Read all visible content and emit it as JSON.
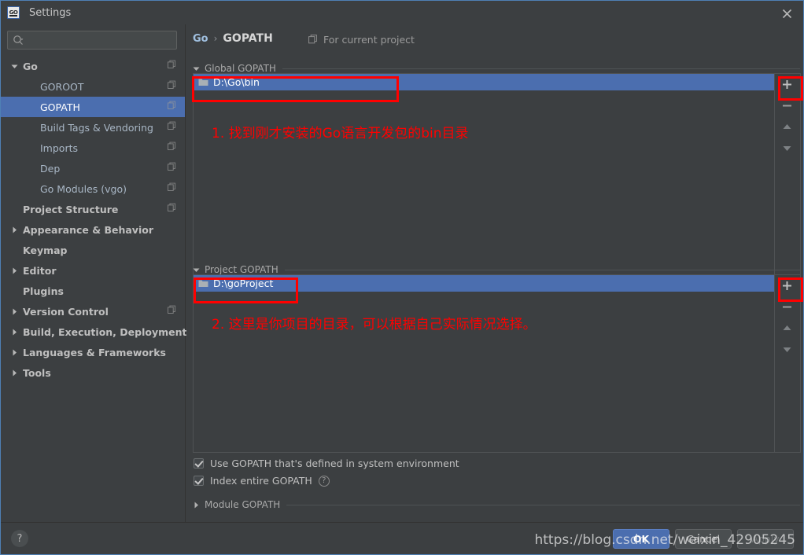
{
  "window": {
    "title": "Settings",
    "app_icon": "go-logo-icon",
    "close_icon": "close-icon",
    "accent_color": "#4b6eaf",
    "background_color": "#3c3f41",
    "annotation_color": "#ff0000"
  },
  "search": {
    "placeholder": "",
    "value": "",
    "icon": "search-icon"
  },
  "sidebar": {
    "items": [
      {
        "label": "Go",
        "indent": 0,
        "twisty": "expanded",
        "bold": true,
        "copy": true,
        "selected": false
      },
      {
        "label": "GOROOT",
        "indent": 1,
        "twisty": "none",
        "bold": false,
        "copy": true,
        "selected": false
      },
      {
        "label": "GOPATH",
        "indent": 1,
        "twisty": "none",
        "bold": false,
        "copy": true,
        "selected": true
      },
      {
        "label": "Build Tags & Vendoring",
        "indent": 1,
        "twisty": "none",
        "bold": false,
        "copy": true,
        "selected": false
      },
      {
        "label": "Imports",
        "indent": 1,
        "twisty": "none",
        "bold": false,
        "copy": true,
        "selected": false
      },
      {
        "label": "Dep",
        "indent": 1,
        "twisty": "none",
        "bold": false,
        "copy": true,
        "selected": false
      },
      {
        "label": "Go Modules (vgo)",
        "indent": 1,
        "twisty": "none",
        "bold": false,
        "copy": true,
        "selected": false
      },
      {
        "label": "Project Structure",
        "indent": 0,
        "twisty": "none",
        "bold": true,
        "copy": true,
        "selected": false
      },
      {
        "label": "Appearance & Behavior",
        "indent": 0,
        "twisty": "collapsed",
        "bold": true,
        "copy": false,
        "selected": false
      },
      {
        "label": "Keymap",
        "indent": 0,
        "twisty": "none",
        "bold": true,
        "copy": false,
        "selected": false
      },
      {
        "label": "Editor",
        "indent": 0,
        "twisty": "collapsed",
        "bold": true,
        "copy": false,
        "selected": false
      },
      {
        "label": "Plugins",
        "indent": 0,
        "twisty": "none",
        "bold": true,
        "copy": false,
        "selected": false
      },
      {
        "label": "Version Control",
        "indent": 0,
        "twisty": "collapsed",
        "bold": true,
        "copy": true,
        "selected": false
      },
      {
        "label": "Build, Execution, Deployment",
        "indent": 0,
        "twisty": "collapsed",
        "bold": true,
        "copy": false,
        "selected": false
      },
      {
        "label": "Languages & Frameworks",
        "indent": 0,
        "twisty": "collapsed",
        "bold": true,
        "copy": false,
        "selected": false
      },
      {
        "label": "Tools",
        "indent": 0,
        "twisty": "collapsed",
        "bold": true,
        "copy": false,
        "selected": false
      }
    ]
  },
  "main": {
    "breadcrumb": {
      "root": "Go",
      "separator": "›",
      "current": "GOPATH"
    },
    "for_current_project": {
      "label": "For current project",
      "icon": "copy-icon"
    },
    "global_gopath": {
      "section_label": "Global GOPATH",
      "expanded": true,
      "entries": [
        {
          "path": "D:\\Go\\bin",
          "selected": true,
          "icon": "folder-icon"
        }
      ],
      "toolbar": [
        {
          "name": "add-button",
          "glyph": "+"
        },
        {
          "name": "remove-button",
          "glyph": "−"
        },
        {
          "name": "move-up-button",
          "glyph": "▲"
        },
        {
          "name": "move-down-button",
          "glyph": "▼"
        }
      ]
    },
    "project_gopath": {
      "section_label": "Project GOPATH",
      "expanded": true,
      "entries": [
        {
          "path": "D:\\goProject",
          "selected": true,
          "icon": "folder-icon"
        }
      ],
      "toolbar": [
        {
          "name": "add-button",
          "glyph": "+"
        },
        {
          "name": "remove-button",
          "glyph": "−"
        },
        {
          "name": "move-up-button",
          "glyph": "▲"
        },
        {
          "name": "move-down-button",
          "glyph": "▼"
        }
      ]
    },
    "options": [
      {
        "label": "Use GOPATH that's defined in system environment",
        "checked": true,
        "help": false
      },
      {
        "label": "Index entire GOPATH",
        "checked": true,
        "help": true
      }
    ],
    "module_gopath": {
      "section_label": "Module GOPATH",
      "expanded": false
    }
  },
  "annotations": [
    {
      "text": "1. 找到刚才安装的Go语言开发包的bin目录"
    },
    {
      "text": "2. 这里是你项目的目录，可以根据自己实际情况选择。"
    }
  ],
  "footer": {
    "help_label": "?",
    "buttons": [
      {
        "label": "OK",
        "style": "primary"
      },
      {
        "label": "Cancel",
        "style": "normal"
      },
      {
        "label": "Apply",
        "style": "disabled"
      }
    ],
    "watermark": "https://blog.csdn.net/weixin_42905245"
  }
}
